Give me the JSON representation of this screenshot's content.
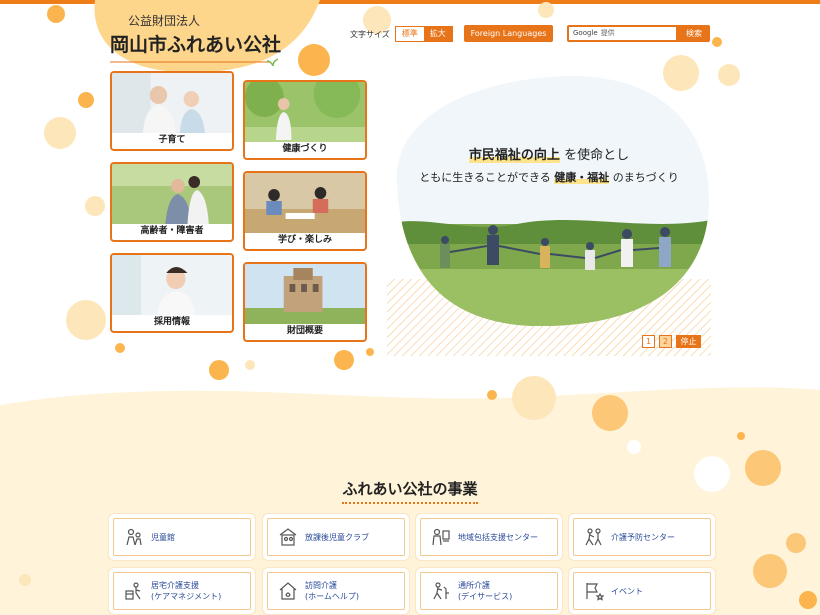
{
  "header": {
    "org_type": "公益財団法人",
    "org_name": "岡山市ふれあい公社",
    "font_size_label": "文字サイズ",
    "font_size_standard": "標準",
    "font_size_large": "拡大",
    "foreign_languages": "Foreign Languages",
    "search_brand": "Google",
    "search_placeholder": "提供",
    "search_button": "検索"
  },
  "menu": [
    {
      "label": "子育て"
    },
    {
      "label": "健康づくり"
    },
    {
      "label": "高齢者・障害者"
    },
    {
      "label": "学び・楽しみ"
    },
    {
      "label": "採用情報"
    },
    {
      "label": "財団概要"
    }
  ],
  "hero": {
    "line1_highlight": "市民福祉の向上",
    "line1_rest": "を使命とし",
    "line2_pre": "ともに生きることができる",
    "line2_highlight": "健康・福祉",
    "line2_post": "のまちづくり"
  },
  "slider": {
    "page1": "1",
    "page2": "2",
    "stop": "停止"
  },
  "section": {
    "title": "ふれあい公社の事業"
  },
  "services": [
    {
      "line1": "児童館",
      "line2": ""
    },
    {
      "line1": "放課後児童クラブ",
      "line2": ""
    },
    {
      "line1": "地域包括支援センター",
      "line2": ""
    },
    {
      "line1": "介護予防センター",
      "line2": ""
    },
    {
      "line1": "居宅介護支援",
      "line2": "(ケアマネジメント)"
    },
    {
      "line1": "訪問介護",
      "line2": "(ホームヘルプ)"
    },
    {
      "line1": "通所介護",
      "line2": "(デイサービス)"
    },
    {
      "line1": "イベント",
      "line2": ""
    }
  ],
  "colors": {
    "accent": "#e8741a",
    "cream": "#fff4d9",
    "dot": "#fcc777"
  }
}
